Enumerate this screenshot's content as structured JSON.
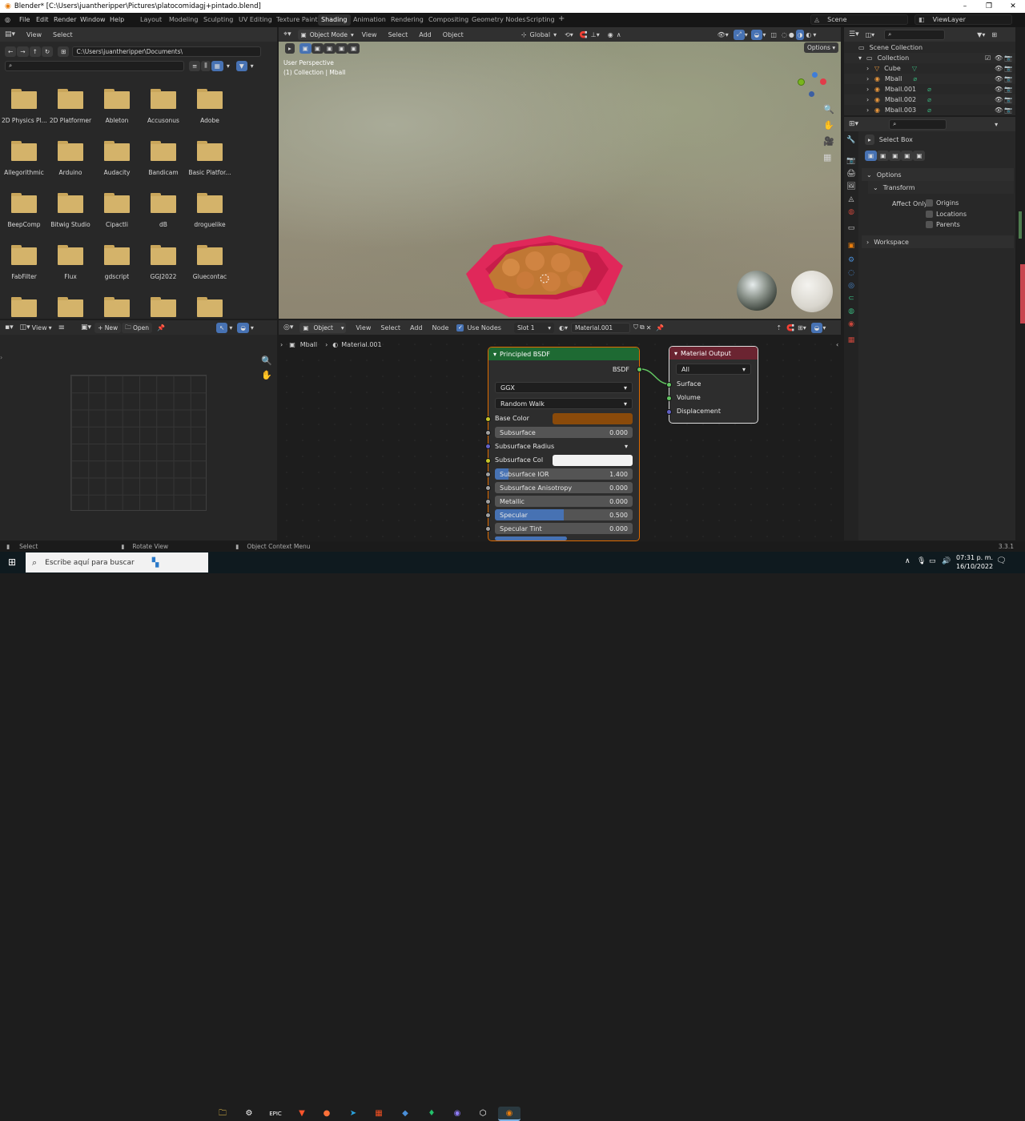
{
  "window": {
    "title": "Blender* [C:\\Users\\juantheripper\\Pictures\\platocomidagj+pintado.blend]",
    "controls": [
      "–",
      "❐",
      "✕"
    ]
  },
  "menubar": {
    "menus": [
      "File",
      "Edit",
      "Render",
      "Window",
      "Help"
    ],
    "workspaces": [
      "Layout",
      "Modeling",
      "Sculpting",
      "UV Editing",
      "Texture Paint",
      "Shading",
      "Animation",
      "Rendering",
      "Compositing",
      "Geometry Nodes",
      "Scripting"
    ],
    "active_workspace": "Shading",
    "add_tab": "+",
    "scene": "Scene",
    "view_layer": "ViewLayer"
  },
  "file_browser": {
    "header_menus": [
      "View",
      "Select"
    ],
    "path": "C:\\Users\\juantheripper\\Documents\\",
    "search_placeholder": "",
    "folders": [
      "2D Physics Pl...",
      "2D Platformer",
      "Ableton",
      "Accusonus",
      "Adobe",
      "Allegorithmic",
      "Arduino",
      "Audacity",
      "Bandicam",
      "Basic Platfor...",
      "BeepComp",
      "Bitwig Studio",
      "Cipactli",
      "dB",
      "droguelike",
      "FabFilter",
      "Flux",
      "gdscript",
      "GGJ2022",
      "Gluecontac",
      "",
      "",
      "",
      "",
      ""
    ]
  },
  "image_editor": {
    "view_menu": "View",
    "new_label": "New",
    "open_label": "Open"
  },
  "viewport": {
    "mode": "Object Mode",
    "menus": [
      "View",
      "Select",
      "Add",
      "Object"
    ],
    "orientation": "Global",
    "options_label": "Options",
    "overlay_line1": "User Perspective",
    "overlay_line2": "(1) Collection | Mball"
  },
  "outliner": {
    "root": "Scene Collection",
    "collection": "Collection",
    "items": [
      "Cube",
      "Mball",
      "Mball.001",
      "Mball.002",
      "Mball.003"
    ]
  },
  "properties": {
    "tool": "Select Box",
    "options_label": "Options",
    "transform_label": "Transform",
    "affect_only_label": "Affect Only",
    "affect_options": [
      "Origins",
      "Locations",
      "Parents"
    ],
    "workspace_label": "Workspace"
  },
  "node_editor": {
    "header": {
      "object_label": "Object",
      "menus": [
        "View",
        "Select",
        "Add",
        "Node"
      ],
      "use_nodes_label": "Use Nodes",
      "slot": "Slot 1",
      "material": "Material.001"
    },
    "breadcrumb": [
      "Mball",
      "Material.001"
    ],
    "bsdf": {
      "title": "Principled BSDF",
      "output_label": "BSDF",
      "distribution": "GGX",
      "subsurface_method": "Random Walk",
      "base_color_label": "Base Color",
      "base_color": "#8a4a0a",
      "subsurface_label": "Subsurface",
      "subsurface_value": "0.000",
      "subsurface_radius_label": "Subsurface Radius",
      "subsurface_col_label": "Subsurface Col",
      "subsurface_ior_label": "Subsurface IOR",
      "subsurface_ior_value": "1.400",
      "anisotropy_label": "Subsurface Anisotropy",
      "anisotropy_value": "0.000",
      "metallic_label": "Metallic",
      "metallic_value": "0.000",
      "specular_label": "Specular",
      "specular_value": "0.500",
      "specular_tint_label": "Specular Tint",
      "specular_tint_value": "0.000"
    },
    "output": {
      "title": "Material Output",
      "target": "All",
      "surface_label": "Surface",
      "volume_label": "Volume",
      "displacement_label": "Displacement"
    }
  },
  "statusbar": {
    "select": "Select",
    "rotate": "Rotate View",
    "context": "Object Context Menu",
    "version": "3.3.1"
  },
  "taskbar": {
    "search_placeholder": "Escribe aquí para buscar",
    "time": "07:31 p. m.",
    "date": "16/10/2022"
  }
}
